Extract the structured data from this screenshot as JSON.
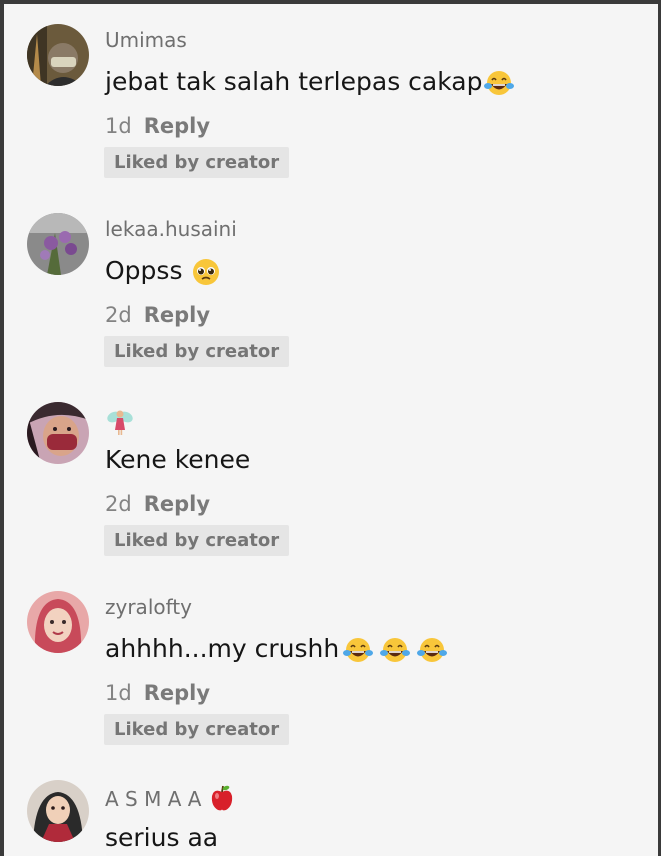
{
  "comments": [
    {
      "username": "Umimas",
      "text": "jebat tak salah terlepas cakap",
      "emoji": [
        "tears-of-joy-emoji"
      ],
      "time": "1d",
      "reply_label": "Reply",
      "badge": "Liked by creator"
    },
    {
      "username": "lekaa.husaini",
      "text": "Oppss",
      "emoji": [
        "pleading-face-emoji"
      ],
      "time": "2d",
      "reply_label": "Reply",
      "badge": "Liked by creator"
    },
    {
      "username": "",
      "username_icon": "fairy-emoji",
      "text": "Kene kenee",
      "emoji": [],
      "time": "2d",
      "reply_label": "Reply",
      "badge": "Liked by creator"
    },
    {
      "username": "zyralofty",
      "text": "ahhhh...my crushh",
      "emoji": [
        "tears-of-joy-emoji",
        "tears-of-joy-emoji",
        "tears-of-joy-emoji"
      ],
      "time": "1d",
      "reply_label": "Reply",
      "badge": "Liked by creator"
    },
    {
      "username": "A S M A A",
      "username_icon": "red-apple-emoji",
      "text": "serius aa"
    }
  ],
  "colors": {
    "background": "#f5f5f5",
    "username": "#6f6f6f",
    "body_text": "#161616",
    "meta": "#838383",
    "badge_bg": "#e5e5e5",
    "badge_text": "#757575"
  }
}
